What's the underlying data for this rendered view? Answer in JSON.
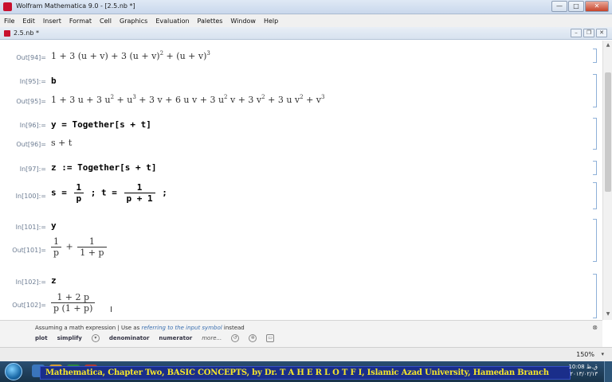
{
  "window": {
    "title": "Wolfram Mathematica 9.0 - [2.5.nb *]"
  },
  "menubar": {
    "items": [
      "File",
      "Edit",
      "Insert",
      "Format",
      "Cell",
      "Graphics",
      "Evaluation",
      "Palettes",
      "Window",
      "Help"
    ]
  },
  "notebook": {
    "title": "2.5.nb *",
    "cells": {
      "out94": {
        "label": "Out[94]="
      },
      "in95": {
        "label": "In[95]:=",
        "input": "b"
      },
      "out95": {
        "label": "Out[95]="
      },
      "in96": {
        "label": "In[96]:=",
        "input": "y = Together[s + t]"
      },
      "out96": {
        "label": "Out[96]=",
        "output": "s + t"
      },
      "in97": {
        "label": "In[97]:=",
        "input": "z := Together[s + t]"
      },
      "in100": {
        "label": "In[100]:=",
        "s_prefix": "s =",
        "num1": "1",
        "den1": "p",
        "t_prefix": "; t =",
        "num2": "1",
        "den2": "p + 1",
        "suffix": ";"
      },
      "in101": {
        "label": "In[101]:=",
        "input": "y"
      },
      "out101": {
        "label": "Out[101]=",
        "num1": "1",
        "den1": "p",
        "plus": "+",
        "num2": "1",
        "den2": "1 + p"
      },
      "in102": {
        "label": "In[102]:=",
        "input": "z"
      },
      "out102": {
        "label": "Out[102]=",
        "num": "1 + 2 p",
        "den": "p (1 + p)"
      }
    }
  },
  "suggestions": {
    "prefix": "Assuming a math expression  |  Use as ",
    "link": "referring to the input symbol",
    "suffix": " instead",
    "buttons": [
      "plot",
      "simplify",
      "denominator",
      "numerator"
    ],
    "more": "more..."
  },
  "status": {
    "zoom": "150%"
  },
  "taskbar": {
    "banner": "Mathematica, Chapter Two, BASIC CONCEPTS,  by Dr. T A H E R    L O T F I, Islamic Azad University, Hamedan Branch",
    "time": "10:08 ق.ظ",
    "date": "۲۰۱۳/۰۲/۱۳"
  },
  "colors": {
    "banner_bg": "#1a2e8a",
    "banner_text": "#f4e52a",
    "cell_label": "#6c7c92",
    "bracket": "#8eb0d8"
  }
}
